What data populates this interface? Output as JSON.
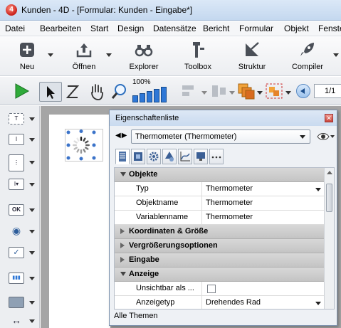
{
  "window": {
    "title": "Kunden - 4D - [Formular: Kunden -  Eingabe*]",
    "app_icon_text": "4"
  },
  "menu": [
    "Datei",
    "Bearbeiten",
    "Start",
    "Design",
    "Datensätze",
    "Bericht",
    "Formular",
    "Objekt",
    "Fenster"
  ],
  "toolbar": {
    "buttons": [
      {
        "label": "Neu",
        "icon": "plus-icon"
      },
      {
        "label": "Öffnen",
        "icon": "open-icon"
      },
      {
        "label": "Explorer",
        "icon": "binoculars-icon"
      },
      {
        "label": "Toolbox",
        "icon": "toolbox-icon"
      },
      {
        "label": "Struktur",
        "icon": "structure-icon"
      },
      {
        "label": "Compiler",
        "icon": "rocket-icon"
      }
    ]
  },
  "toolbar2": {
    "zoom_label": "100%",
    "page_label": "1/1"
  },
  "palette": {
    "items": [
      {
        "icon": "static-text-icon",
        "glyph": "T"
      },
      {
        "icon": "field-icon",
        "glyph": "I"
      },
      {
        "icon": "list-icon",
        "glyph": "⋮"
      },
      {
        "icon": "combo-icon",
        "glyph": "I▾"
      },
      {
        "icon": "button-icon",
        "glyph": "OK"
      },
      {
        "icon": "radio-icon",
        "glyph": "◉"
      },
      {
        "icon": "checkbox-icon",
        "glyph": "✓"
      },
      {
        "icon": "thermometer-icon",
        "glyph": "▮▮▮"
      },
      {
        "icon": "rectangle-icon",
        "glyph": "■"
      },
      {
        "icon": "line-icon",
        "glyph": "↔"
      }
    ]
  },
  "properties": {
    "title": "Eigenschaftenliste",
    "selected_object": "Thermometer (Thermometer)",
    "sections": {
      "objekte": "Objekte",
      "koordinaten": "Koordinaten & Größe",
      "vergroesserung": "Vergrößerungsoptionen",
      "eingabe": "Eingabe",
      "anzeige": "Anzeige"
    },
    "rows": {
      "typ": {
        "key": "Typ",
        "value": "Thermometer"
      },
      "objektname": {
        "key": "Objektname",
        "value": "Thermometer"
      },
      "variablenname": {
        "key": "Variablenname",
        "value": "Thermometer"
      },
      "unsichtbar": {
        "key": "Unsichtbar als ...",
        "checked": false
      },
      "anzeigetyp": {
        "key": "Anzeigetyp",
        "value": "Drehendes Rad"
      }
    },
    "footer": "Alle Themen"
  }
}
